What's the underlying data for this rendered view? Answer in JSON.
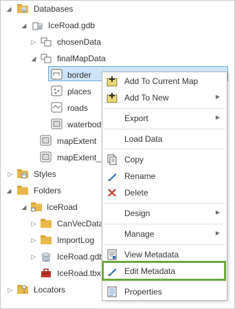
{
  "tree": {
    "databases": "Databases",
    "gdb": "IceRoad.gdb",
    "chosen": "chosenData",
    "final": "finalMapData",
    "border": "border",
    "places": "places",
    "roads": "roads",
    "waterbod": "waterbod",
    "mapExtent": "mapExtent",
    "mapExtentE": "mapExtent_E",
    "styles": "Styles",
    "folders": "Folders",
    "iceroad": "IceRoad",
    "canvec": "CanVecData",
    "importlog": "ImportLog",
    "iceroadgdb": "IceRoad.gdb",
    "tbx": "IceRoad.tbx",
    "locators": "Locators"
  },
  "menu": {
    "add_current": "Add To Current Map",
    "add_new": "Add To New",
    "export": "Export",
    "load": "Load Data",
    "copy": "Copy",
    "rename": "Rename",
    "delete": "Delete",
    "design": "Design",
    "manage": "Manage",
    "view_meta": "View Metadata",
    "edit_meta": "Edit Metadata",
    "properties": "Properties"
  },
  "colors": {
    "folder": "#e8b84a",
    "selection": "#cde3f7",
    "highlight": "#6aa83a",
    "delete_x": "#c0392b",
    "pencil": "#2f6fbf"
  }
}
